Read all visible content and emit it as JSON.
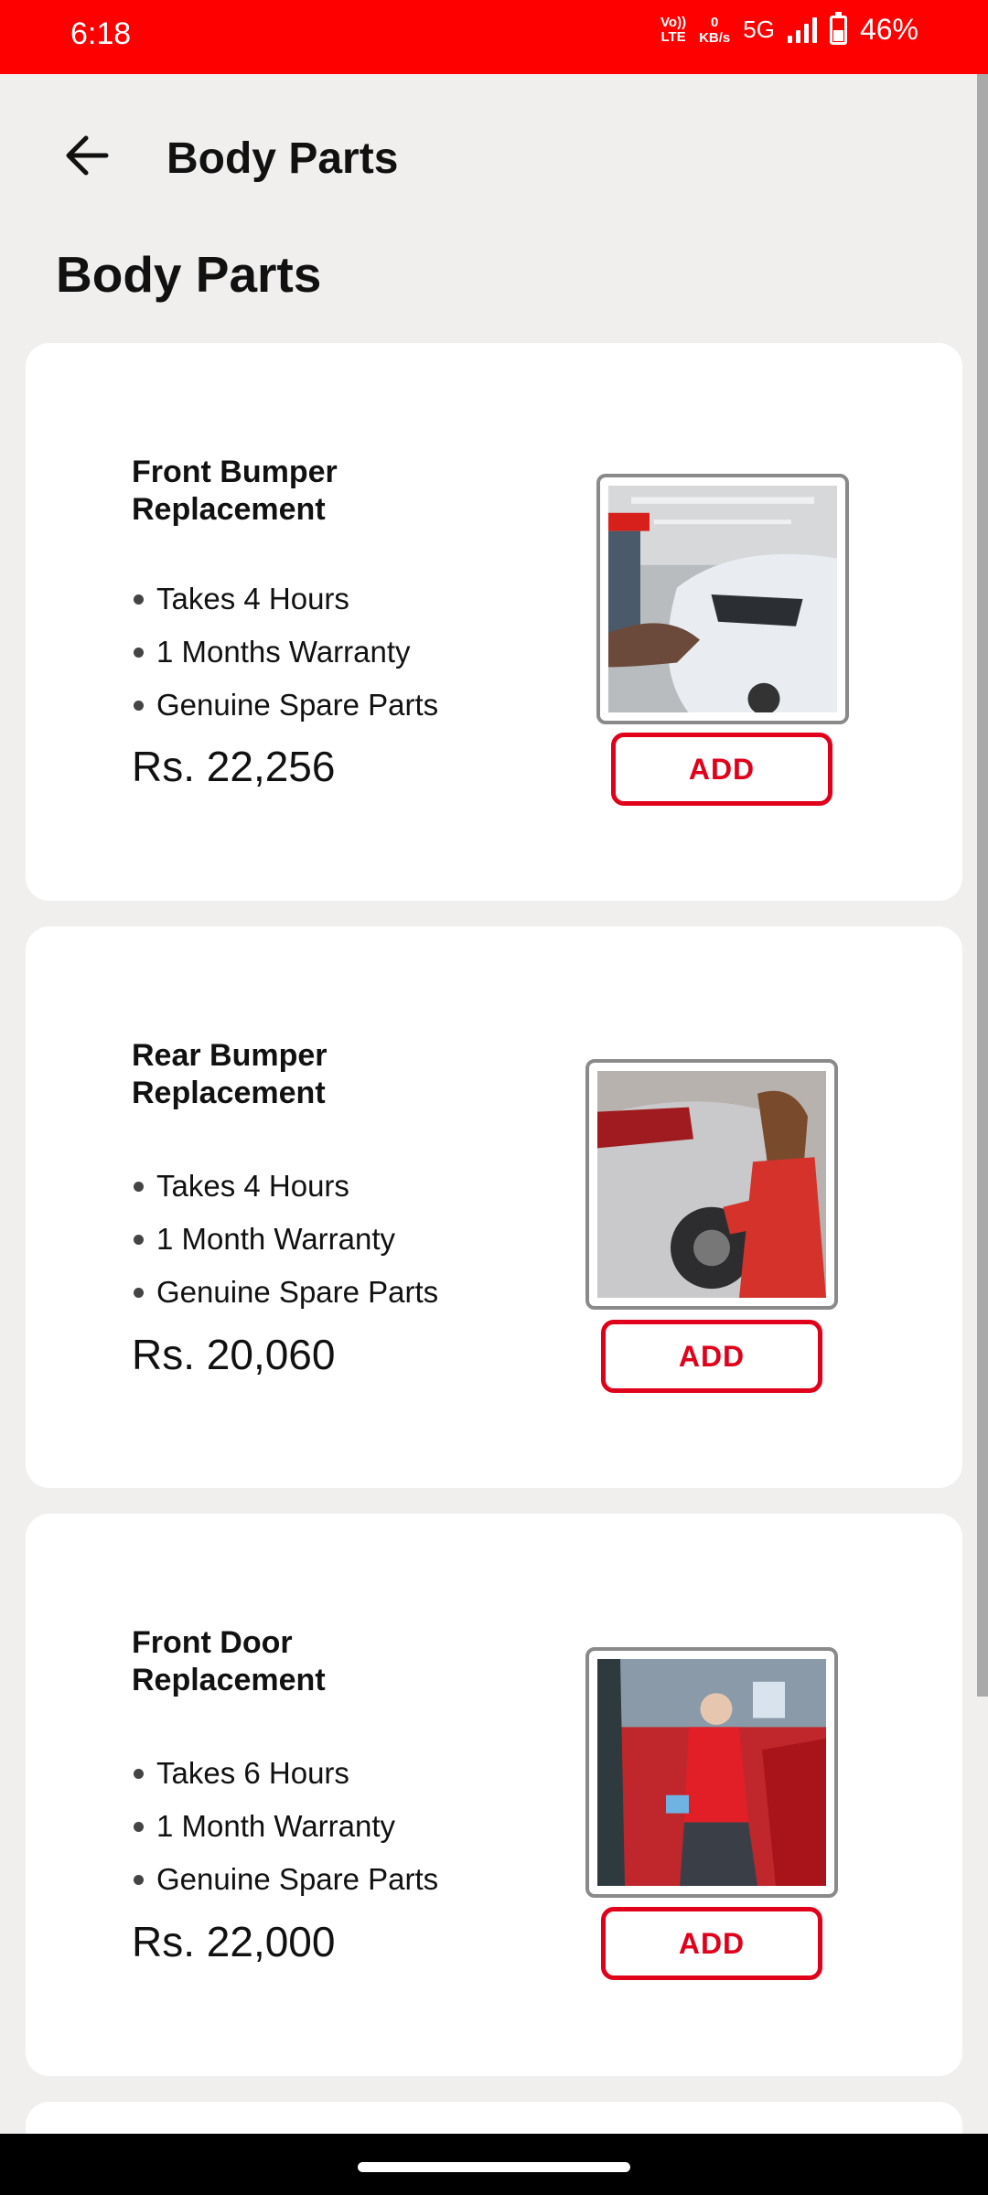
{
  "status_bar": {
    "time": "6:18",
    "volte_top": "Vo))",
    "volte_bottom": "LTE",
    "speed_value": "0",
    "speed_unit": "KB/s",
    "network": "5G",
    "battery": "46%",
    "battery_level_percent": 46,
    "icons": [
      "volte-icon",
      "signal-icon",
      "battery-icon"
    ]
  },
  "header": {
    "back_icon": "arrow-left-icon",
    "title": "Body Parts"
  },
  "section": {
    "title": "Body Parts"
  },
  "services": [
    {
      "name": "Front Bumper Replacement",
      "features": [
        "Takes 4 Hours",
        "1 Months Warranty",
        "Genuine Spare Parts"
      ],
      "price": "Rs. 22,256",
      "button": "ADD"
    },
    {
      "name": "Rear Bumper Replacement",
      "features": [
        "Takes 4 Hours",
        "1 Month Warranty",
        "Genuine Spare Parts"
      ],
      "price": "Rs. 20,060",
      "button": "ADD"
    },
    {
      "name": "Front Door Replacement",
      "features": [
        "Takes 6 Hours",
        "1 Month Warranty",
        "Genuine Spare Parts"
      ],
      "price": "Rs. 22,000",
      "button": "ADD"
    }
  ],
  "colors": {
    "status_bar": "#fe0000",
    "accent": "#e0001a",
    "background": "#f1efee",
    "card": "#ffffff"
  }
}
